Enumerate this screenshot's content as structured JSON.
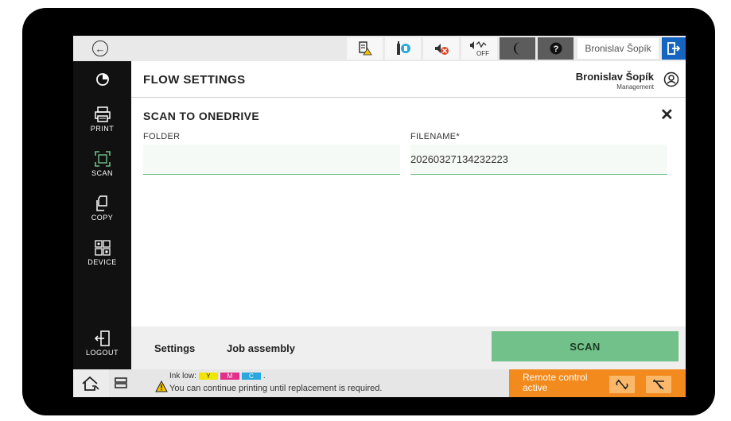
{
  "status_bar": {
    "user": "Bronislav Šopík",
    "icons": [
      "toner-warning-icon",
      "device-info-icon",
      "sound-muted-icon",
      "sound-off-icon",
      "sleep-moon-icon",
      "help-icon"
    ],
    "sound_badge": "OFF"
  },
  "sidebar": {
    "items": [
      {
        "label": "PRINT",
        "icon": "print-icon"
      },
      {
        "label": "SCAN",
        "icon": "scan-icon"
      },
      {
        "label": "COPY",
        "icon": "copy-icon"
      },
      {
        "label": "DEVICE",
        "icon": "device-icon"
      }
    ],
    "logout_label": "LOGOUT"
  },
  "header": {
    "title": "FLOW SETTINGS",
    "user_name": "Bronislav Šopík",
    "user_role": "Management"
  },
  "panel": {
    "title": "SCAN TO ONEDRIVE",
    "close": "✕",
    "folder_label": "FOLDER",
    "folder_value": "",
    "filename_label": "FILENAME*",
    "filename_value": "20260327134232223"
  },
  "actions": {
    "settings": "Settings",
    "job_assembly": "Job assembly",
    "scan": "SCAN"
  },
  "footer": {
    "ink_low": "Ink low:",
    "ink_colors": [
      {
        "label": "Y",
        "color": "#f2e600"
      },
      {
        "label": "M",
        "color": "#e0308a"
      },
      {
        "label": "C",
        "color": "#29a8e0"
      }
    ],
    "ink_suffix": ".",
    "message": "You can continue printing until replacement is required.",
    "remote_control": "Remote control active"
  },
  "colors": {
    "accent_green": "#72c08a",
    "remote_orange": "#f28a1e",
    "logout_blue": "#1565c0"
  }
}
